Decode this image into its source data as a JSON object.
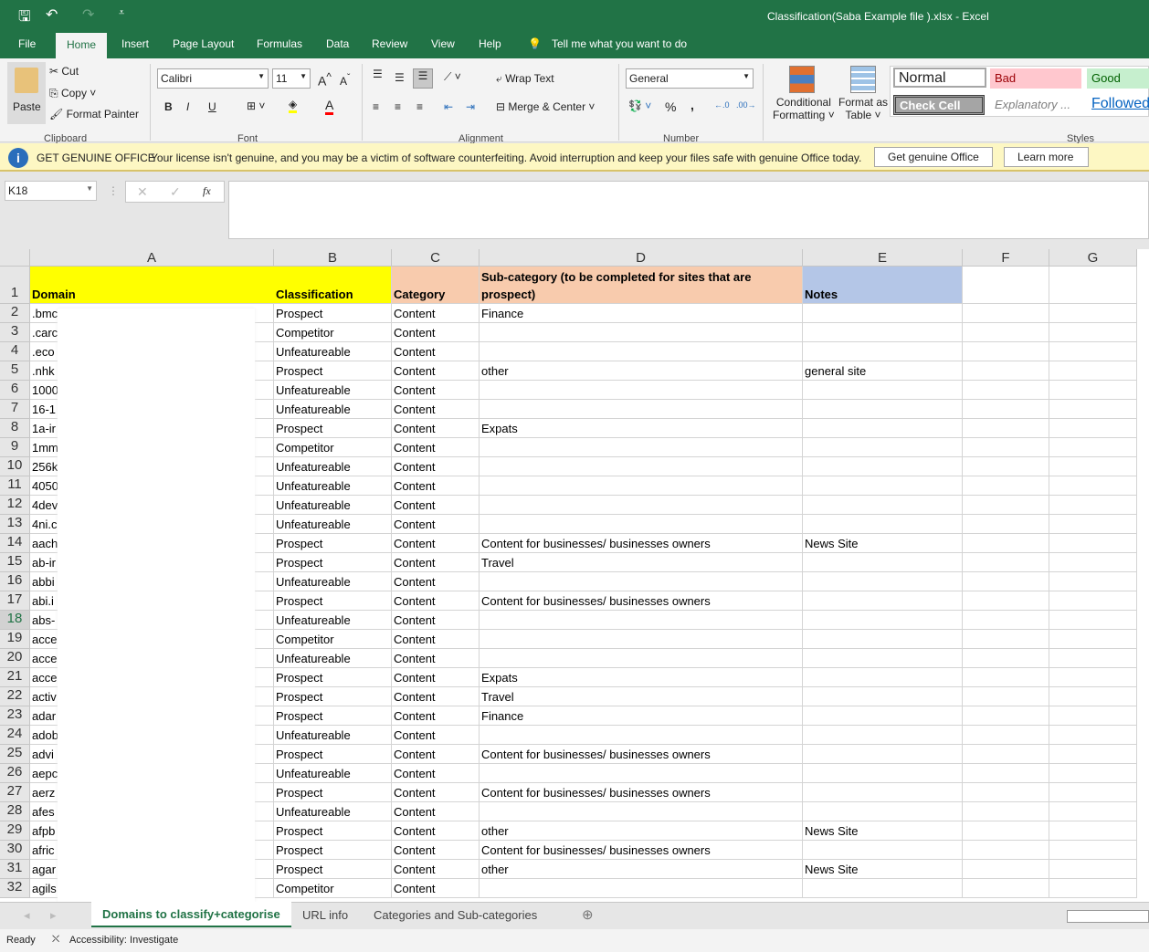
{
  "title": "Classification(Saba Example file ).xlsx  -  Excel",
  "ribbon_tabs": [
    "File",
    "Home",
    "Insert",
    "Page Layout",
    "Formulas",
    "Data",
    "Review",
    "View",
    "Help"
  ],
  "tell_me": "Tell me what you want to do",
  "clipboard": {
    "paste": "Paste",
    "cut": "Cut",
    "copy": "Copy",
    "format_painter": "Format Painter",
    "label": "Clipboard"
  },
  "font": {
    "name": "Calibri",
    "size": "11",
    "label": "Font",
    "bold": "B",
    "italic": "I",
    "underline": "U"
  },
  "alignment": {
    "wrap": "Wrap Text",
    "merge": "Merge & Center",
    "label": "Alignment"
  },
  "number": {
    "format": "General",
    "percent": "%",
    "comma": ",",
    "label": "Number"
  },
  "styles": {
    "conditional": "Conditional",
    "conditional2": "Formatting",
    "format_table": "Format as",
    "format_table2": "Table",
    "normal": "Normal",
    "bad": "Bad",
    "good": "Good",
    "check": "Check Cell",
    "explanatory": "Explanatory ...",
    "followed": "Followed",
    "label": "Styles"
  },
  "message": {
    "title": "GET GENUINE OFFICE",
    "text": "Your license isn't genuine, and you may be a victim of software counterfeiting. Avoid interruption and keep your files safe with genuine Office today.",
    "btn1": "Get genuine Office",
    "btn2": "Learn more"
  },
  "formula_bar": {
    "name_box": "K18",
    "fx": "fx",
    "value": ""
  },
  "columns": [
    "A",
    "B",
    "C",
    "D",
    "E",
    "F",
    "G"
  ],
  "header_row": {
    "num": "1",
    "a": "Domain",
    "b": "Classification",
    "c": "Category",
    "d": "Sub-category (to be completed for sites that are prospect)",
    "e": "Notes"
  },
  "colors": {
    "yellow": "#ffff00",
    "orange": "#f8cbad",
    "blue": "#b4c6e7",
    "excel_green": "#217346"
  },
  "rows": [
    [
      "2",
      ".bmc",
      "Prospect",
      "Content",
      "Finance",
      ""
    ],
    [
      "3",
      ".carc",
      "Competitor",
      "Content",
      "",
      ""
    ],
    [
      "4",
      ".eco",
      "Unfeatureable",
      "Content",
      "",
      ""
    ],
    [
      "5",
      ".nhk",
      "Prospect",
      "Content",
      "other",
      "general site"
    ],
    [
      "6",
      "1000",
      "Unfeatureable",
      "Content",
      "",
      ""
    ],
    [
      "7",
      "16-1",
      "Unfeatureable",
      "Content",
      "",
      ""
    ],
    [
      "8",
      "1a-ir",
      "Prospect",
      "Content",
      "Expats",
      ""
    ],
    [
      "9",
      "1mm",
      "Competitor",
      "Content",
      "",
      ""
    ],
    [
      "10",
      "256k",
      "Unfeatureable",
      "Content",
      "",
      ""
    ],
    [
      "11",
      "4050",
      "Unfeatureable",
      "Content",
      "",
      ""
    ],
    [
      "12",
      "4dev",
      "Unfeatureable",
      "Content",
      "",
      ""
    ],
    [
      "13",
      "4ni.c",
      "Unfeatureable",
      "Content",
      "",
      ""
    ],
    [
      "14",
      "aach",
      "Prospect",
      "Content",
      "Content for businesses/ businesses owners",
      "News Site"
    ],
    [
      "15",
      "ab-ir",
      "Prospect",
      "Content",
      "Travel",
      ""
    ],
    [
      "16",
      "abbi",
      "Unfeatureable",
      "Content",
      "",
      ""
    ],
    [
      "17",
      "abi.i",
      "Prospect",
      "Content",
      "Content for businesses/ businesses owners",
      ""
    ],
    [
      "18",
      "abs-",
      "Unfeatureable",
      "Content",
      "",
      ""
    ],
    [
      "19",
      "acce",
      "Competitor",
      "Content",
      "",
      ""
    ],
    [
      "20",
      "acce",
      "Unfeatureable",
      "Content",
      "",
      ""
    ],
    [
      "21",
      "acce",
      "Prospect",
      "Content",
      "Expats",
      ""
    ],
    [
      "22",
      "activ",
      "Prospect",
      "Content",
      "Travel",
      ""
    ],
    [
      "23",
      "adar",
      "Prospect",
      "Content",
      "Finance",
      ""
    ],
    [
      "24",
      "adob",
      "Unfeatureable",
      "Content",
      "",
      ""
    ],
    [
      "25",
      "advi",
      "Prospect",
      "Content",
      "Content for businesses/ businesses owners",
      ""
    ],
    [
      "26",
      "aepc",
      "Unfeatureable",
      "Content",
      "",
      ""
    ],
    [
      "27",
      "aerz",
      "Prospect",
      "Content",
      "Content for businesses/ businesses owners",
      ""
    ],
    [
      "28",
      "afes",
      "Unfeatureable",
      "Content",
      "",
      ""
    ],
    [
      "29",
      "afpb",
      "Prospect",
      "Content",
      "other",
      "News Site"
    ],
    [
      "30",
      "afric",
      "Prospect",
      "Content",
      "Content for businesses/ businesses owners",
      ""
    ],
    [
      "31",
      "agar",
      "Prospect",
      "Content",
      "other",
      "News Site"
    ],
    [
      "32",
      "agils",
      "Competitor",
      "Content",
      "",
      ""
    ]
  ],
  "sheets": [
    "Domains to classify+categorise",
    "URL info",
    "Categories and Sub-categories"
  ],
  "status": {
    "ready": "Ready",
    "accessibility": "Accessibility: Investigate"
  }
}
